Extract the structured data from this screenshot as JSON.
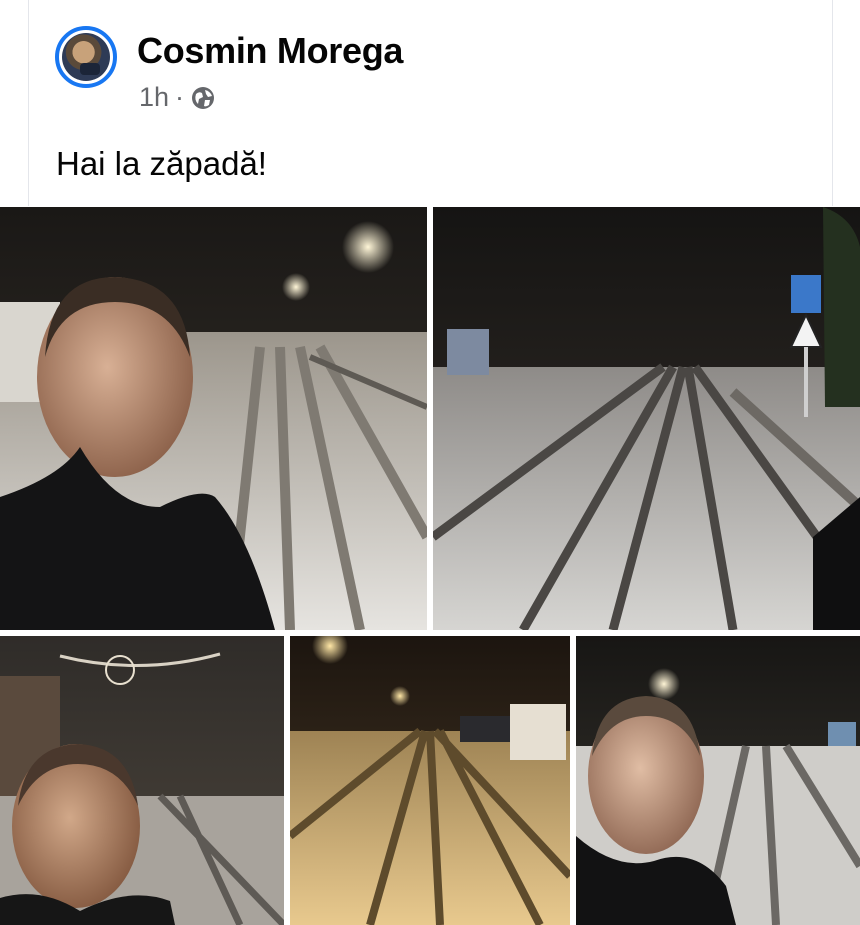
{
  "post": {
    "author": "Cosmin Morega",
    "time": "1h",
    "separator": "·",
    "audience_icon": "globe-icon",
    "text": "Hai la zăpadă!"
  },
  "photos": [
    {
      "description_icon": "photo"
    },
    {
      "description_icon": "photo"
    },
    {
      "description_icon": "photo"
    },
    {
      "description_icon": "photo"
    },
    {
      "description_icon": "photo"
    }
  ],
  "colors": {
    "avatar_ring": "#1877f2",
    "name": "#050505",
    "meta": "#65676b"
  }
}
